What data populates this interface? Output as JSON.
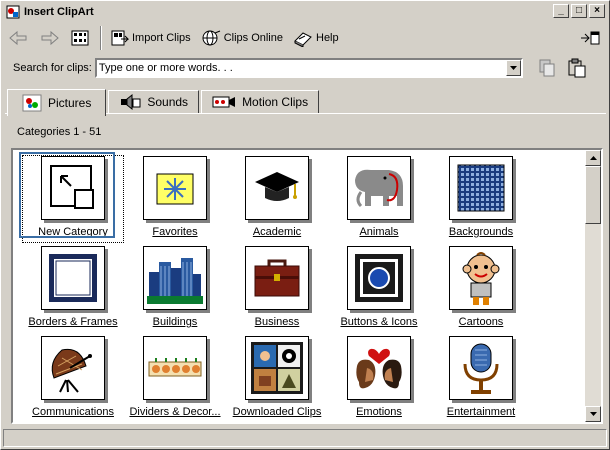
{
  "window": {
    "title": "Insert ClipArt"
  },
  "toolbar": {
    "import_label": "Import Clips",
    "online_label": "Clips Online",
    "help_label": "Help"
  },
  "search": {
    "label": "Search for clips:",
    "placeholder": "Type one or more words. . ."
  },
  "tabs": [
    {
      "label": "Pictures",
      "active": true
    },
    {
      "label": "Sounds",
      "active": false
    },
    {
      "label": "Motion Clips",
      "active": false
    }
  ],
  "categories_label": "Categories 1 - 51",
  "categories": [
    {
      "label": "New Category",
      "icon": "new-category-icon"
    },
    {
      "label": "Favorites",
      "icon": "favorites-icon"
    },
    {
      "label": "Academic",
      "icon": "academic-icon"
    },
    {
      "label": "Animals",
      "icon": "animals-icon"
    },
    {
      "label": "Backgrounds",
      "icon": "backgrounds-icon"
    },
    {
      "label": "Borders & Frames",
      "icon": "borders-icon"
    },
    {
      "label": "Buildings",
      "icon": "buildings-icon"
    },
    {
      "label": "Business",
      "icon": "business-icon"
    },
    {
      "label": "Buttons & Icons",
      "icon": "buttons-icon"
    },
    {
      "label": "Cartoons",
      "icon": "cartoons-icon"
    },
    {
      "label": "Communications",
      "icon": "communications-icon"
    },
    {
      "label": "Dividers & Decor...",
      "icon": "dividers-icon"
    },
    {
      "label": "Downloaded Clips",
      "icon": "downloaded-icon"
    },
    {
      "label": "Emotions",
      "icon": "emotions-icon"
    },
    {
      "label": "Entertainment",
      "icon": "entertainment-icon"
    }
  ]
}
